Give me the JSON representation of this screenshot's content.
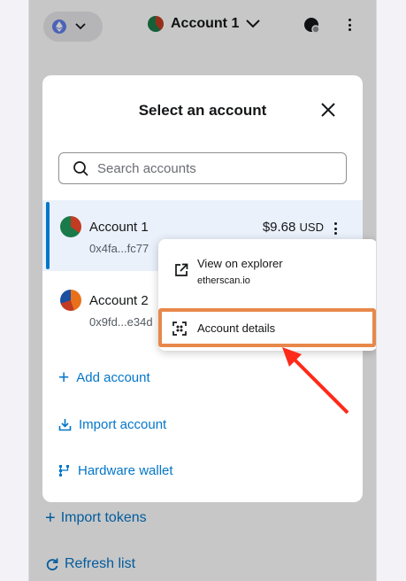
{
  "header": {
    "network_icon": "ethereum-icon",
    "account_name": "Account 1",
    "connected_icon": "globe-icon",
    "menu_icon": "kebab-menu-icon"
  },
  "background": {
    "import_tokens": "Import tokens",
    "refresh_list": "Refresh list"
  },
  "modal": {
    "title": "Select an account",
    "search_placeholder": "Search accounts",
    "accounts": [
      {
        "name": "Account 1",
        "address": "0x4fa...fc77",
        "balance": "$9.68",
        "currency": "USD",
        "selected": true
      },
      {
        "name": "Account 2",
        "address": "0x9fd...e34d"
      }
    ],
    "actions": {
      "add_account": "Add account",
      "import_account": "Import account",
      "hardware_wallet": "Hardware wallet"
    }
  },
  "popup_menu": {
    "view_on_explorer": "View on explorer",
    "explorer_host": "etherscan.io",
    "account_details": "Account details"
  },
  "colors": {
    "accent": "#0376c9",
    "highlight_box": "#e8884a",
    "annotation_arrow": "#ff2a1a",
    "selected_row": "#ebf1fb"
  }
}
